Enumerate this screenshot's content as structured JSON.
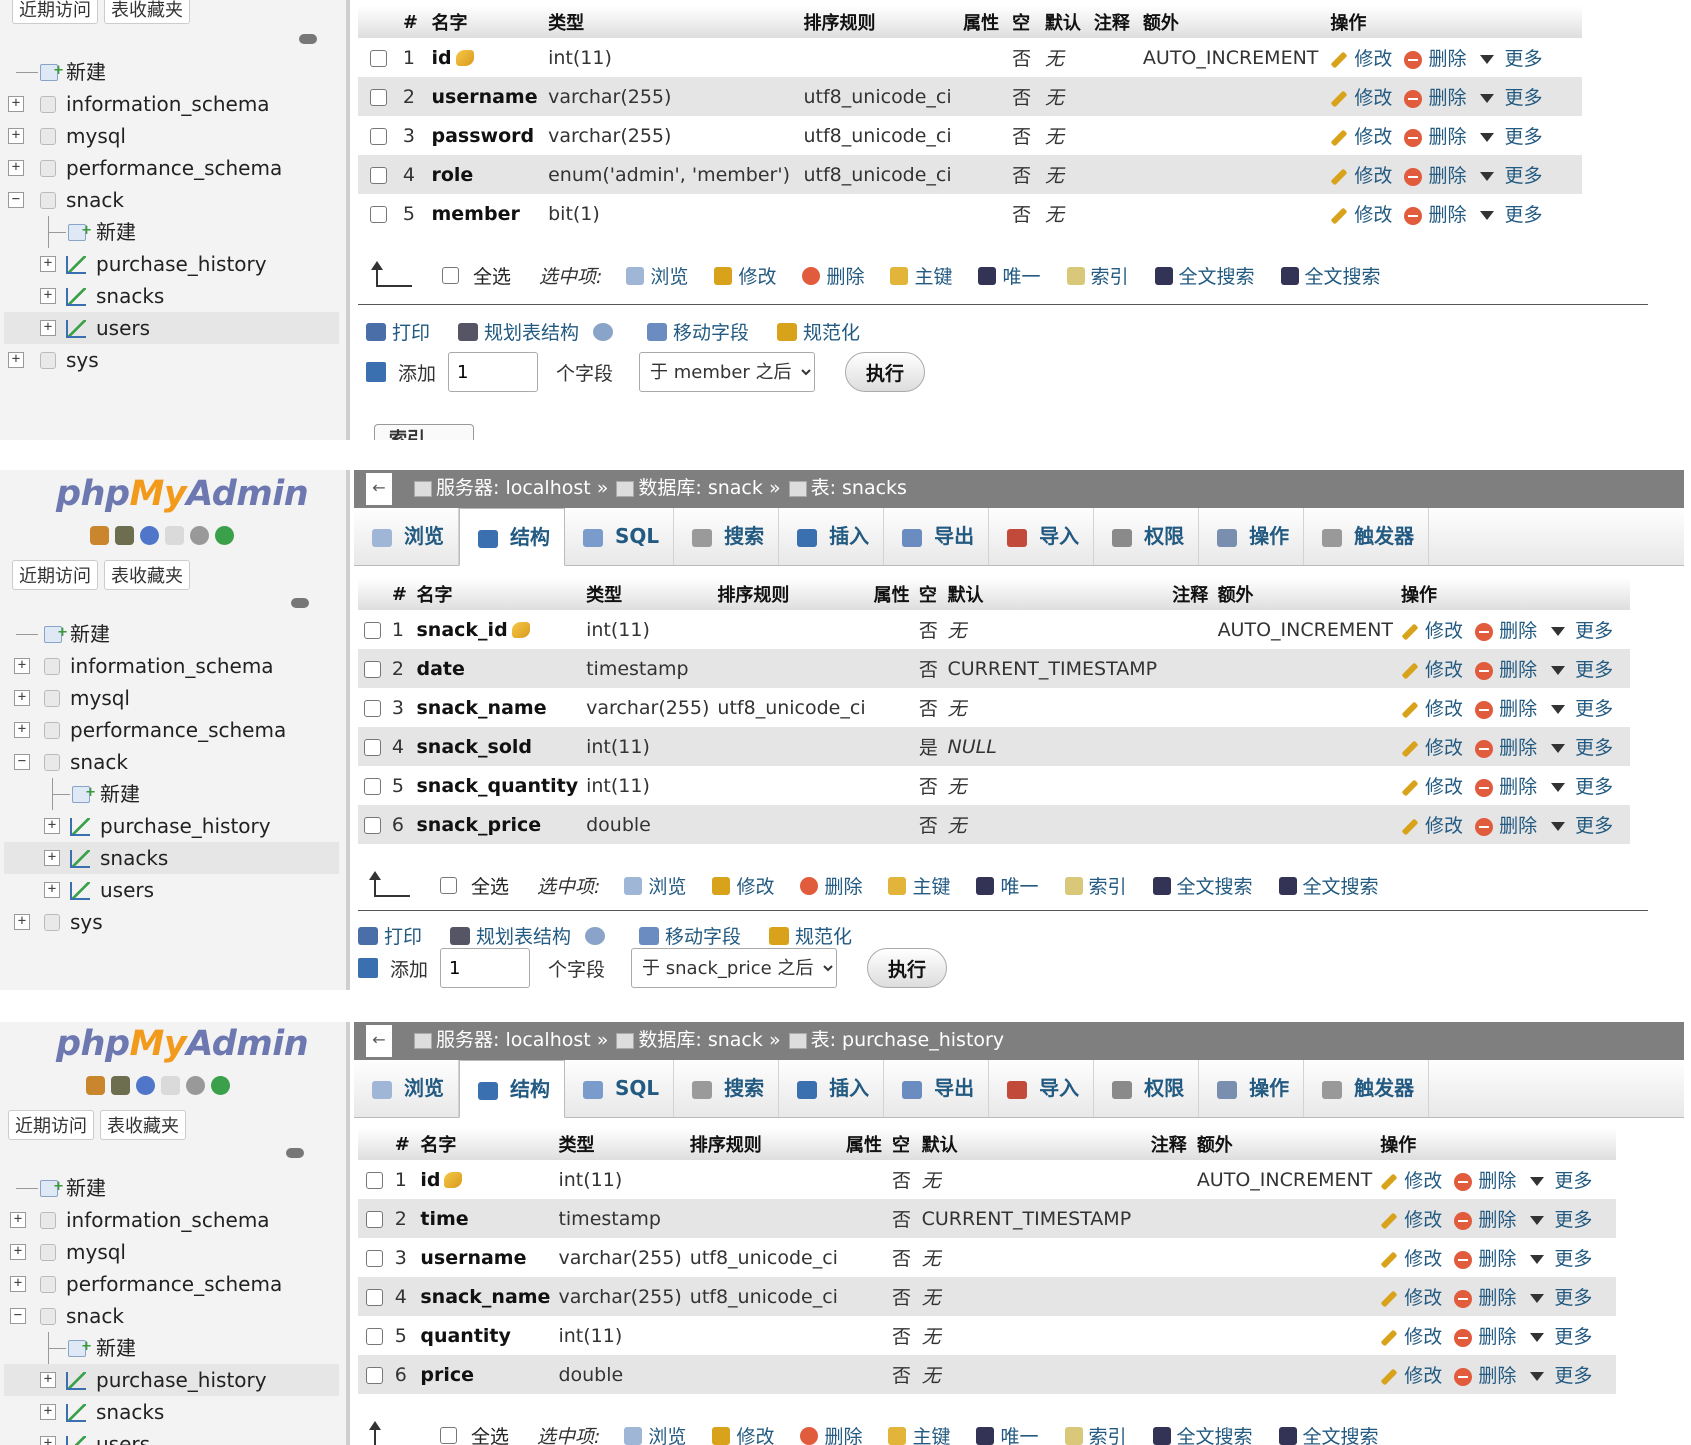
{
  "nav": {
    "recent": "近期访问",
    "favorites": "表收藏夹",
    "new": "新建",
    "databases": [
      "information_schema",
      "mysql",
      "performance_schema",
      "snack",
      "sys"
    ],
    "snack_tables": [
      "purchase_history",
      "snacks",
      "users"
    ]
  },
  "logo": {
    "php": "php",
    "my": "My",
    "admin": "Admin"
  },
  "crumb": {
    "server": "服务器: localhost",
    "sep": "»",
    "db": "数据库: snack",
    "table_snacks": "表: snacks",
    "table_ph": "表: purchase_history"
  },
  "tabs": [
    "浏览",
    "结构",
    "SQL",
    "搜索",
    "插入",
    "导出",
    "导入",
    "权限",
    "操作",
    "触发器"
  ],
  "headers": {
    "num": "#",
    "name": "名字",
    "type": "类型",
    "collation": "排序规则",
    "attributes": "属性",
    "null": "空",
    "default": "默认",
    "comment": "注释",
    "extra": "额外",
    "action": "操作"
  },
  "actions": {
    "edit": "修改",
    "drop": "删除",
    "more": "更多"
  },
  "bulk": {
    "check_all": "全选",
    "with_selected": "选中项:",
    "browse": "浏览",
    "edit": "修改",
    "drop": "删除",
    "primary": "主键",
    "unique": "唯一",
    "index": "索引",
    "fulltext1": "全文搜索",
    "fulltext2": "全文搜索"
  },
  "tools": {
    "print": "打印",
    "propose": "规划表结构",
    "move": "移动字段",
    "normalize": "规范化"
  },
  "add": {
    "label": "添加",
    "count": "1",
    "fields": "个字段",
    "go": "执行"
  },
  "users": {
    "after": "于 member 之后",
    "index_tab": "索引",
    "rows": [
      {
        "num": "1",
        "name": "id",
        "key": true,
        "type": "int(11)",
        "collation": "",
        "null": "否",
        "default": "无",
        "extra": "AUTO_INCREMENT"
      },
      {
        "num": "2",
        "name": "username",
        "type": "varchar(255)",
        "collation": "utf8_unicode_ci",
        "null": "否",
        "default": "无",
        "extra": ""
      },
      {
        "num": "3",
        "name": "password",
        "type": "varchar(255)",
        "collation": "utf8_unicode_ci",
        "null": "否",
        "default": "无",
        "extra": ""
      },
      {
        "num": "4",
        "name": "role",
        "type": "enum('admin', 'member')",
        "collation": "utf8_unicode_ci",
        "null": "否",
        "default": "无",
        "extra": ""
      },
      {
        "num": "5",
        "name": "member",
        "type": "bit(1)",
        "collation": "",
        "null": "否",
        "default": "无",
        "extra": ""
      }
    ]
  },
  "snacks": {
    "after": "于 snack_price 之后",
    "rows": [
      {
        "num": "1",
        "name": "snack_id",
        "key": true,
        "type": "int(11)",
        "collation": "",
        "null": "否",
        "default": "无",
        "extra": "AUTO_INCREMENT"
      },
      {
        "num": "2",
        "name": "date",
        "type": "timestamp",
        "collation": "",
        "null": "否",
        "default": "CURRENT_TIMESTAMP",
        "extra": ""
      },
      {
        "num": "3",
        "name": "snack_name",
        "type": "varchar(255)",
        "collation": "utf8_unicode_ci",
        "null": "否",
        "default": "无",
        "extra": ""
      },
      {
        "num": "4",
        "name": "snack_sold",
        "type": "int(11)",
        "collation": "",
        "null": "是",
        "default": "NULL",
        "extra": ""
      },
      {
        "num": "5",
        "name": "snack_quantity",
        "type": "int(11)",
        "collation": "",
        "null": "否",
        "default": "无",
        "extra": ""
      },
      {
        "num": "6",
        "name": "snack_price",
        "type": "double",
        "collation": "",
        "null": "否",
        "default": "无",
        "extra": ""
      }
    ]
  },
  "purchase_history": {
    "rows": [
      {
        "num": "1",
        "name": "id",
        "key": true,
        "type": "int(11)",
        "collation": "",
        "null": "否",
        "default": "无",
        "extra": "AUTO_INCREMENT"
      },
      {
        "num": "2",
        "name": "time",
        "type": "timestamp",
        "collation": "",
        "null": "否",
        "default": "CURRENT_TIMESTAMP",
        "extra": ""
      },
      {
        "num": "3",
        "name": "username",
        "type": "varchar(255)",
        "collation": "utf8_unicode_ci",
        "null": "否",
        "default": "无",
        "extra": ""
      },
      {
        "num": "4",
        "name": "snack_name",
        "type": "varchar(255)",
        "collation": "utf8_unicode_ci",
        "null": "否",
        "default": "无",
        "extra": ""
      },
      {
        "num": "5",
        "name": "quantity",
        "type": "int(11)",
        "collation": "",
        "null": "否",
        "default": "无",
        "extra": ""
      },
      {
        "num": "6",
        "name": "price",
        "type": "double",
        "collation": "",
        "null": "否",
        "default": "无",
        "extra": ""
      }
    ]
  },
  "colors": {
    "link": "#235a81",
    "logo_blue": "#6c78af",
    "logo_orange": "#f29a1b",
    "even_row": "#e5e5e5",
    "crumb_bg": "#7f7f7f"
  }
}
